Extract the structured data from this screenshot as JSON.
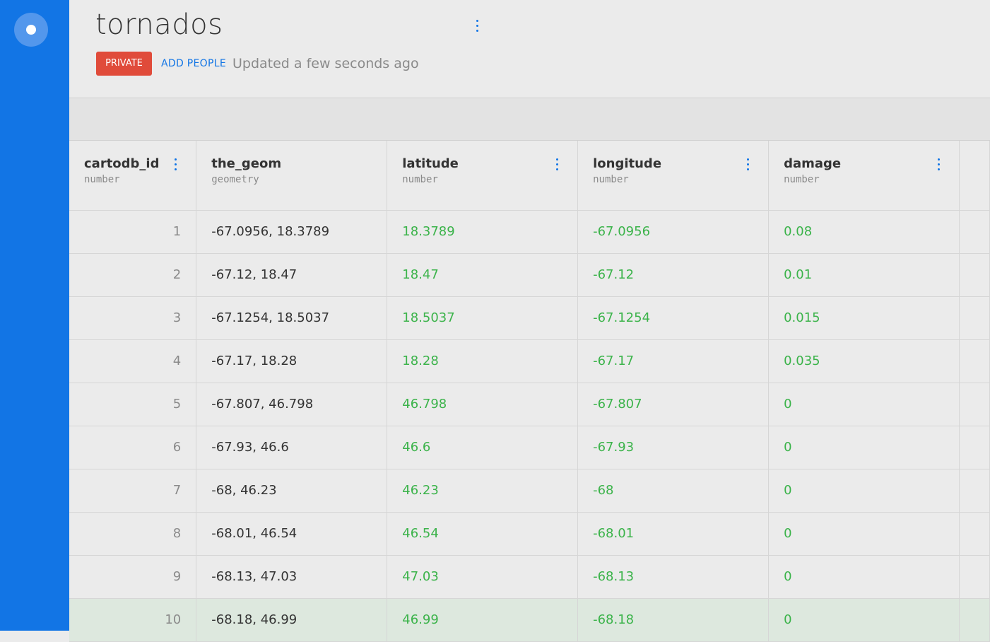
{
  "dataset": {
    "title": "tornados",
    "privacy_label": "PRIVATE",
    "add_people_label": "ADD PEOPLE",
    "updated_text": "Updated a few seconds ago"
  },
  "colors": {
    "sidebar": "#1275e5",
    "private_badge": "#e04b3a",
    "link": "#1275e5",
    "numeric_value": "#3bb34a"
  },
  "table": {
    "columns": [
      {
        "name": "cartodb_id",
        "type": "number"
      },
      {
        "name": "the_geom",
        "type": "geometry"
      },
      {
        "name": "latitude",
        "type": "number"
      },
      {
        "name": "longitude",
        "type": "number"
      },
      {
        "name": "damage",
        "type": "number"
      }
    ],
    "rows": [
      {
        "cartodb_id": "1",
        "the_geom": "-67.0956, 18.3789",
        "latitude": "18.3789",
        "longitude": "-67.0956",
        "damage": "0.08"
      },
      {
        "cartodb_id": "2",
        "the_geom": "-67.12, 18.47",
        "latitude": "18.47",
        "longitude": "-67.12",
        "damage": "0.01"
      },
      {
        "cartodb_id": "3",
        "the_geom": "-67.1254, 18.5037",
        "latitude": "18.5037",
        "longitude": "-67.1254",
        "damage": "0.015"
      },
      {
        "cartodb_id": "4",
        "the_geom": "-67.17, 18.28",
        "latitude": "18.28",
        "longitude": "-67.17",
        "damage": "0.035"
      },
      {
        "cartodb_id": "5",
        "the_geom": "-67.807, 46.798",
        "latitude": "46.798",
        "longitude": "-67.807",
        "damage": "0"
      },
      {
        "cartodb_id": "6",
        "the_geom": "-67.93, 46.6",
        "latitude": "46.6",
        "longitude": "-67.93",
        "damage": "0"
      },
      {
        "cartodb_id": "7",
        "the_geom": "-68, 46.23",
        "latitude": "46.23",
        "longitude": "-68",
        "damage": "0"
      },
      {
        "cartodb_id": "8",
        "the_geom": "-68.01, 46.54",
        "latitude": "46.54",
        "longitude": "-68.01",
        "damage": "0"
      },
      {
        "cartodb_id": "9",
        "the_geom": "-68.13, 47.03",
        "latitude": "47.03",
        "longitude": "-68.13",
        "damage": "0"
      },
      {
        "cartodb_id": "10",
        "the_geom": "-68.18, 46.99",
        "latitude": "46.99",
        "longitude": "-68.18",
        "damage": "0"
      }
    ]
  }
}
